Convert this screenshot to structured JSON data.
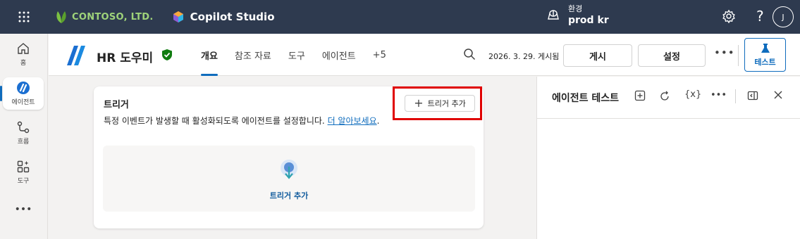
{
  "header": {
    "brand": "CONTOSO, LTD.",
    "product": "Copilot Studio",
    "environment_label": "환경",
    "environment_value": "prod kr",
    "avatar_initial": "J",
    "help_label": "?"
  },
  "leftnav": {
    "items": [
      {
        "label": "홈",
        "icon": "home-icon"
      },
      {
        "label": "에이전트",
        "icon": "agent-icon"
      },
      {
        "label": "흐름",
        "icon": "flow-icon"
      },
      {
        "label": "도구",
        "icon": "tools-icon"
      }
    ],
    "more": "•••"
  },
  "agent": {
    "name": "HR 도우미",
    "tabs": [
      "개요",
      "참조 자료",
      "도구",
      "에이전트",
      "+5"
    ],
    "active_tab": "개요",
    "published": "2026. 3. 29. 게시됨",
    "publish_label": "게시",
    "settings_label": "설정",
    "more_label": "•••",
    "test_label": "테스트"
  },
  "trigger_card": {
    "title": "트리거",
    "add_button": "트리거 추가",
    "description": "특정 이벤트가 발생할 때 활성화되도록 에이전트를 설정합니다.",
    "learn_more": "더 알아보세요",
    "empty_action": "트리거 추가"
  },
  "test_panel": {
    "title": "에이전트 테스트",
    "variables_label": "{x}",
    "more_label": "•••"
  },
  "colors": {
    "header_bg": "#2e3a4f",
    "accent": "#0f6cbd",
    "highlight": "#e00000"
  }
}
